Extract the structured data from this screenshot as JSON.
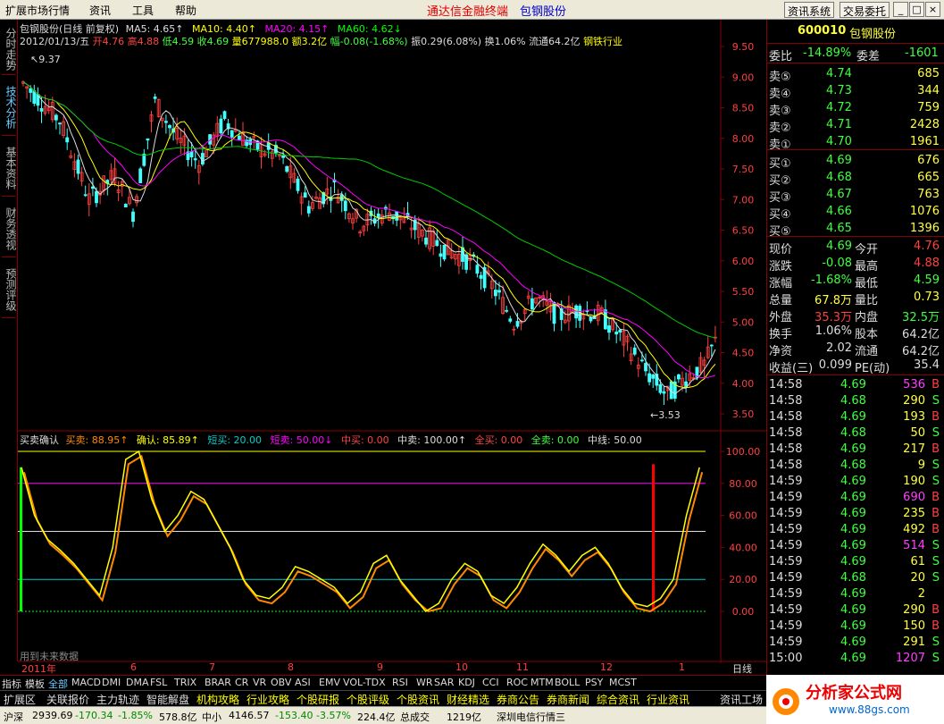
{
  "menu": {
    "items": [
      "扩展市场行情",
      "资讯",
      "工具",
      "帮助"
    ],
    "center_title": "通达信金融终端",
    "center_stock": "包钢股份",
    "btn_news": "资讯系统",
    "btn_trade": "交易委托"
  },
  "left_tabs": [
    "分时走势",
    "技术分析",
    "基本资料",
    "财务透视",
    "预测评级"
  ],
  "chart": {
    "header1": "包钢股份(日线 前复权)",
    "ma5": "MA5: 4.65↑",
    "ma10": "MA10: 4.40↑",
    "ma20": "MA20: 4.15↑",
    "ma60": "MA60: 4.62↓",
    "info_line": "2012/01/13/五",
    "info_open": "开4.76",
    "info_high": "高4.88",
    "info_low": "低4.59",
    "info_close": "收4.69",
    "info_vol": "量677988.0",
    "info_amt": "额3.2亿",
    "info_chg": "幅-0.08(-1.68%)",
    "info_amp": "振0.29(6.08%)",
    "info_turn": "换1.06%",
    "info_float": "流通64.2亿",
    "info_ind": "钢铁行业",
    "high_mark": "9.37",
    "low_mark": "3.53",
    "y_labels": [
      "9.50",
      "9.00",
      "8.50",
      "8.00",
      "7.50",
      "7.00",
      "6.50",
      "6.00",
      "5.50",
      "5.00",
      "4.50",
      "4.00",
      "3.50"
    ],
    "ind_title": "买卖确认",
    "ind_buy": "买卖: 88.95↑",
    "ind_confirm": "确认: 85.89↑",
    "ind_short_buy": "短买: 20.00",
    "ind_short_sell": "短卖: 50.00↓",
    "ind_mid_buy": "中买: 0.00",
    "ind_mid_sell": "中卖: 100.00↑",
    "ind_all_buy": "全买: 0.00",
    "ind_all_sell": "全卖: 0.00",
    "ind_midline": "中线: 50.00",
    "ind_y": [
      "100.00",
      "80.00",
      "60.00",
      "40.00",
      "20.00",
      "0.00"
    ],
    "ind_footer": "用到未来数据",
    "dates": [
      "2011年",
      "6",
      "7",
      "8",
      "9",
      "10",
      "11",
      "12",
      "1"
    ],
    "daily_label": "日线"
  },
  "quote": {
    "code": "600010",
    "name": "包钢股份",
    "weibi_label": "委比",
    "weibi": "-14.89%",
    "weicha_label": "委差",
    "weicha": "-1601",
    "asks": [
      {
        "label": "卖⑤",
        "price": "4.74",
        "vol": "685"
      },
      {
        "label": "卖④",
        "price": "4.73",
        "vol": "344"
      },
      {
        "label": "卖③",
        "price": "4.72",
        "vol": "759"
      },
      {
        "label": "卖②",
        "price": "4.71",
        "vol": "2428"
      },
      {
        "label": "卖①",
        "price": "4.70",
        "vol": "1961"
      }
    ],
    "bids": [
      {
        "label": "买①",
        "price": "4.69",
        "vol": "676"
      },
      {
        "label": "买②",
        "price": "4.68",
        "vol": "665"
      },
      {
        "label": "买③",
        "price": "4.67",
        "vol": "763"
      },
      {
        "label": "买④",
        "price": "4.66",
        "vol": "1076"
      },
      {
        "label": "买⑤",
        "price": "4.65",
        "vol": "1396"
      }
    ],
    "stats": [
      {
        "l1": "现价",
        "v1": "4.69",
        "c1": "g",
        "l2": "今开",
        "v2": "4.76",
        "c2": "r"
      },
      {
        "l1": "涨跌",
        "v1": "-0.08",
        "c1": "g",
        "l2": "最高",
        "v2": "4.88",
        "c2": "r"
      },
      {
        "l1": "涨幅",
        "v1": "-1.68%",
        "c1": "g",
        "l2": "最低",
        "v2": "4.59",
        "c2": "g"
      },
      {
        "l1": "总量",
        "v1": "67.8万",
        "c1": "y",
        "l2": "量比",
        "v2": "0.73",
        "c2": "y"
      },
      {
        "l1": "外盘",
        "v1": "35.3万",
        "c1": "r",
        "l2": "内盘",
        "v2": "32.5万",
        "c2": "g"
      },
      {
        "l1": "换手",
        "v1": "1.06%",
        "c1": "w",
        "l2": "股本",
        "v2": "64.2亿",
        "c2": "w"
      },
      {
        "l1": "净资",
        "v1": "2.02",
        "c1": "w",
        "l2": "流通",
        "v2": "64.2亿",
        "c2": "w"
      },
      {
        "l1": "收益(三)",
        "v1": "0.099",
        "c1": "w",
        "l2": "PE(动)",
        "v2": "35.4",
        "c2": "w"
      }
    ],
    "ticks": [
      {
        "t": "14:58",
        "p": "4.69",
        "v": "536",
        "vc": "m",
        "d": "B",
        "dc": "r"
      },
      {
        "t": "14:58",
        "p": "4.68",
        "v": "290",
        "vc": "y",
        "d": "S",
        "dc": "g"
      },
      {
        "t": "14:58",
        "p": "4.69",
        "v": "193",
        "vc": "y",
        "d": "B",
        "dc": "r"
      },
      {
        "t": "14:58",
        "p": "4.68",
        "v": "50",
        "vc": "y",
        "d": "S",
        "dc": "g"
      },
      {
        "t": "14:58",
        "p": "4.69",
        "v": "217",
        "vc": "y",
        "d": "B",
        "dc": "r"
      },
      {
        "t": "14:58",
        "p": "4.68",
        "v": "9",
        "vc": "y",
        "d": "S",
        "dc": "g"
      },
      {
        "t": "14:59",
        "p": "4.69",
        "v": "190",
        "vc": "y",
        "d": "S",
        "dc": "g"
      },
      {
        "t": "14:59",
        "p": "4.69",
        "v": "690",
        "vc": "m",
        "d": "B",
        "dc": "r"
      },
      {
        "t": "14:59",
        "p": "4.69",
        "v": "235",
        "vc": "y",
        "d": "B",
        "dc": "r"
      },
      {
        "t": "14:59",
        "p": "4.69",
        "v": "492",
        "vc": "y",
        "d": "B",
        "dc": "r"
      },
      {
        "t": "14:59",
        "p": "4.69",
        "v": "514",
        "vc": "m",
        "d": "S",
        "dc": "g"
      },
      {
        "t": "14:59",
        "p": "4.69",
        "v": "61",
        "vc": "y",
        "d": "S",
        "dc": "g"
      },
      {
        "t": "14:59",
        "p": "4.68",
        "v": "20",
        "vc": "y",
        "d": "S",
        "dc": "g"
      },
      {
        "t": "14:59",
        "p": "4.69",
        "v": "2",
        "vc": "y",
        "d": "",
        "dc": "g"
      },
      {
        "t": "14:59",
        "p": "4.69",
        "v": "290",
        "vc": "y",
        "d": "B",
        "dc": "r"
      },
      {
        "t": "14:59",
        "p": "4.69",
        "v": "150",
        "vc": "y",
        "d": "B",
        "dc": "r"
      },
      {
        "t": "14:59",
        "p": "4.69",
        "v": "291",
        "vc": "y",
        "d": "S",
        "dc": "g"
      },
      {
        "t": "15:00",
        "p": "4.69",
        "v": "1207",
        "vc": "m",
        "d": "S",
        "dc": "g"
      }
    ]
  },
  "tabs": [
    "指标",
    "模板",
    "全部",
    "MACD",
    "DMI",
    "DMA",
    "FSL",
    "TRIX",
    "BRAR",
    "CR",
    "VR",
    "OBV",
    "ASI",
    "EMV",
    "VOL-TDX",
    "RSI",
    "WR",
    "SAR",
    "KDJ",
    "CCI",
    "ROC",
    "MTM",
    "BOLL",
    "PSY",
    "MCST"
  ],
  "bottom": [
    "扩展区",
    "关联报价",
    "主力轨迹",
    "智能解盘",
    "机构攻略",
    "行业攻略",
    "个股研报",
    "个股评级",
    "个股资讯",
    "财经精选",
    "券商公告",
    "券商新闻",
    "综合资讯",
    "行业资讯",
    "资讯工场"
  ],
  "status": [
    "沪深",
    "2939.69",
    "-170.34",
    "-1.85%",
    "578.8亿",
    "中小",
    "4146.57",
    "-153.40",
    "-3.57%",
    "224.4亿",
    "总成交",
    "1219亿",
    "深圳电信行情三"
  ],
  "logo": {
    "text": "分析家公式网",
    "url": "www.88gs.com"
  }
}
